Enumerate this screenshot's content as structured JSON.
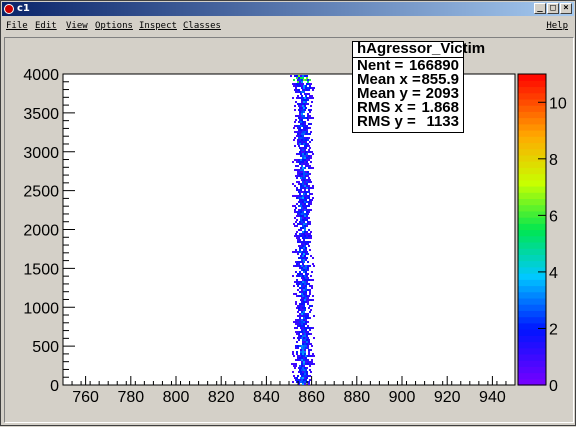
{
  "window": {
    "title": "c1",
    "controls": [
      "_",
      "□",
      "×"
    ]
  },
  "menubar": {
    "items": [
      "File",
      "Edit",
      "View",
      "Options",
      "Inspect",
      "Classes"
    ],
    "help": "Help"
  },
  "stats_box": {
    "name": "hAgressor_Victim",
    "rows": [
      {
        "label": "Nent = ",
        "value": "166890"
      },
      {
        "label": "Mean x = ",
        "value": "855.9"
      },
      {
        "label": "Mean y = ",
        "value": "2093"
      },
      {
        "label": "RMS x = ",
        "value": "1.868"
      },
      {
        "label": "RMS y = ",
        "value": "1133"
      }
    ]
  },
  "chart_data": {
    "type": "heatmap",
    "title": "",
    "xlabel": "",
    "ylabel": "",
    "xlim": [
      750,
      950
    ],
    "ylim": [
      0,
      4000
    ],
    "x_ticks": [
      760,
      780,
      800,
      820,
      840,
      860,
      880,
      900,
      920,
      940
    ],
    "y_ticks": [
      0,
      500,
      1000,
      1500,
      2000,
      2500,
      3000,
      3500,
      4000
    ],
    "x_tick_labels": [
      "760",
      "780",
      "800",
      "820",
      "840",
      "860",
      "880",
      "900",
      "920",
      "940"
    ],
    "y_tick_labels": [
      "0",
      "500",
      "1000",
      "1500",
      "2000",
      "2500",
      "3000",
      "3500",
      "4000"
    ],
    "colorbar": {
      "range": [
        0,
        11
      ],
      "ticks": [
        0,
        2,
        4,
        6,
        8,
        10
      ],
      "tick_labels": [
        "0",
        "2",
        "4",
        "6",
        "8",
        "10"
      ]
    },
    "band": {
      "x_center": 855.9,
      "x_rms": 1.868,
      "y_min": 0,
      "y_max": 4000
    },
    "grid": false
  }
}
